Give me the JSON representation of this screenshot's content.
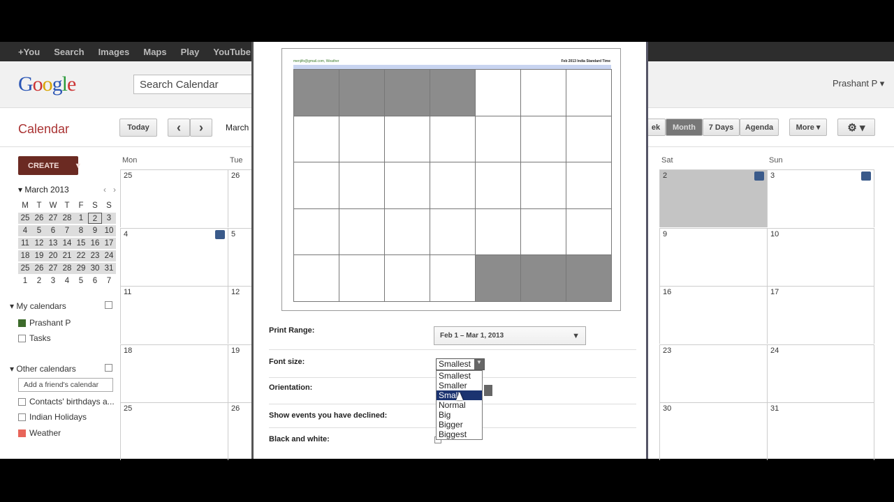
{
  "gnav": [
    "+You",
    "Search",
    "Images",
    "Maps",
    "Play",
    "YouTube"
  ],
  "header": {
    "logo": "Google",
    "search_placeholder": "Search Calendar",
    "user": "Prashant P ▾"
  },
  "toolbar": {
    "title": "Calendar",
    "today": "Today",
    "prev": "‹",
    "next": "›",
    "period": "March",
    "views": [
      "ek",
      "Month",
      "7 Days",
      "Agenda"
    ],
    "more": "More ▾",
    "settings_icon": "gear-icon"
  },
  "sidebar": {
    "create": "CREATE",
    "create_arrow": "▼",
    "mini": {
      "title": "March 2013",
      "weekdays": [
        "M",
        "T",
        "W",
        "T",
        "F",
        "S",
        "S"
      ],
      "days": [
        "25",
        "26",
        "27",
        "28",
        "1",
        "2",
        "3",
        "4",
        "5",
        "6",
        "7",
        "8",
        "9",
        "10",
        "11",
        "12",
        "13",
        "14",
        "15",
        "16",
        "17",
        "18",
        "19",
        "20",
        "21",
        "22",
        "23",
        "24",
        "25",
        "26",
        "27",
        "28",
        "29",
        "30",
        "31",
        "1",
        "2",
        "3",
        "4",
        "5",
        "6",
        "7"
      ]
    },
    "my_calendars": "My calendars",
    "my_items": [
      {
        "label": "Prashant P",
        "color": "#3d6b2b"
      },
      {
        "label": "Tasks",
        "color": ""
      }
    ],
    "other_calendars": "Other calendars",
    "add_friend": "Add a friend's calendar",
    "other_items": [
      {
        "label": "Contacts' birthdays a...",
        "color": ""
      },
      {
        "label": "Indian Holidays",
        "color": ""
      },
      {
        "label": "Weather",
        "color": "#e8655a"
      }
    ]
  },
  "grid": {
    "left_headers": [
      "Mon",
      "Tue"
    ],
    "right_headers": [
      "Sat",
      "Sun"
    ],
    "mon": [
      "25",
      "4",
      "11",
      "18",
      "25"
    ],
    "tue": [
      "26",
      "5",
      "12",
      "19",
      "26"
    ],
    "sat": [
      "2",
      "9",
      "16",
      "23",
      "30"
    ],
    "sun": [
      "3",
      "10",
      "17",
      "24",
      "31"
    ]
  },
  "print": {
    "preview_header_left": "menjifo@gmail.com, Weather",
    "preview_header_right": "Feb 2013 India Standard Time",
    "range_label": "Print Range:",
    "range_value": "Feb 1 – Mar 1, 2013",
    "font_label": "Font size:",
    "font_value": "Smallest",
    "font_options": [
      "Smallest",
      "Smaller",
      "Small",
      "Normal",
      "Big",
      "Bigger",
      "Biggest"
    ],
    "font_highlighted": "Small",
    "orientation_label": "Orientation:",
    "declined_label": "Show events you have declined:",
    "bw_label": "Black and white:"
  }
}
